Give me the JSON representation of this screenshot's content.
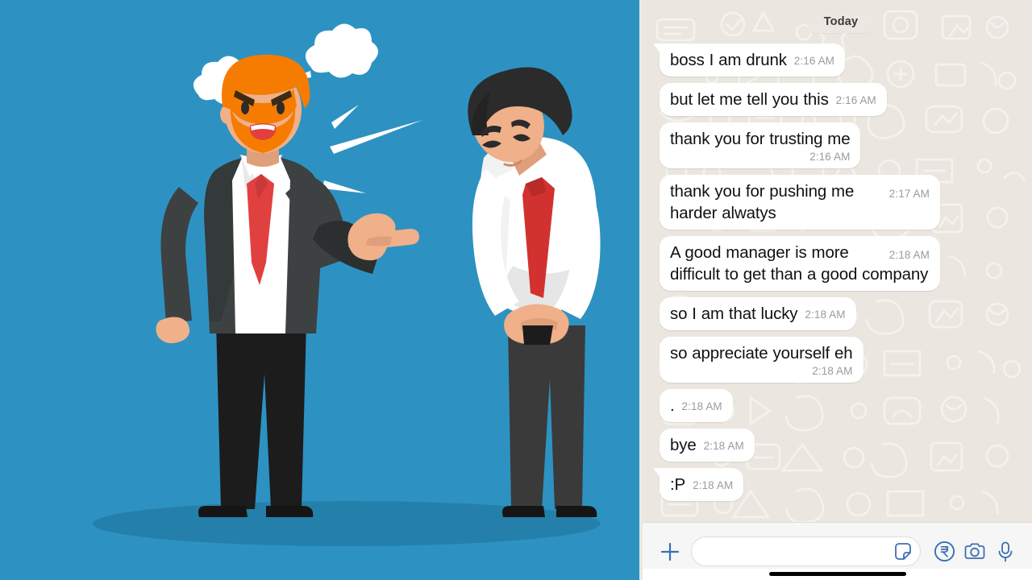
{
  "app": {
    "name": "WhatsApp Chat Screenshot",
    "background_color": "#ebe7e0",
    "accent_color": "#3b6fb5"
  },
  "illustration": {
    "name": "angry-boss-scolding-employee",
    "background_color": "#2d92c2",
    "ground_shadow_color": "#2480ab",
    "boss": {
      "hair_color": "#f57c00",
      "beard_color": "#f57c00",
      "suit_color": "#3d4142",
      "shirt_color": "#ffffff",
      "tie_color": "#e0413f",
      "skin_color": "#f0b089",
      "trousers_color": "#1c1c1c"
    },
    "employee": {
      "hair_color": "#2b2b2b",
      "shirt_color": "#ffffff",
      "tie_color": "#d1322f",
      "skin_color": "#f0b089",
      "trousers_color": "#3a3a3a"
    },
    "effects": {
      "steam_cloud_color": "#ffffff",
      "shout_line_color": "#ffffff",
      "steam_cloud_count": 2,
      "shout_line_count": 4
    }
  },
  "chat": {
    "day_divider": "Today",
    "messages": [
      {
        "text": "boss I am drunk",
        "time": "2:16 AM",
        "layout": "inline",
        "tail": true
      },
      {
        "text": "but let me tell you this",
        "time": "2:16 AM",
        "layout": "inline",
        "tail": false
      },
      {
        "text": "thank you for trusting me",
        "time": "2:16 AM",
        "layout": "wrapped",
        "tail": false
      },
      {
        "text": "thank you for pushing me harder alwatys",
        "time": "2:17 AM",
        "layout": "float",
        "tail": false
      },
      {
        "text": "A good manager is more difficult to get than a good company",
        "time": "2:18 AM",
        "layout": "float",
        "tail": false
      },
      {
        "text": "so I am that lucky",
        "time": "2:18 AM",
        "layout": "inline",
        "tail": false
      },
      {
        "text": "so appreciate yourself eh",
        "time": "2:18 AM",
        "layout": "wrapped",
        "tail": false
      },
      {
        "text": ".",
        "time": "2:18 AM",
        "layout": "inline",
        "tail": false
      },
      {
        "text": "bye",
        "time": "2:18 AM",
        "layout": "inline",
        "tail": false
      },
      {
        "text": ":P",
        "time": "2:18 AM",
        "layout": "inline",
        "tail": true
      }
    ]
  },
  "input_bar": {
    "attach_icon": "plus-icon",
    "input_value": "",
    "input_placeholder": "",
    "sticker_icon": "sticker-icon",
    "payment_icon": "rupee-payment-icon",
    "camera_icon": "camera-icon",
    "mic_icon": "microphone-icon",
    "icon_color": "#3b6fb5"
  }
}
